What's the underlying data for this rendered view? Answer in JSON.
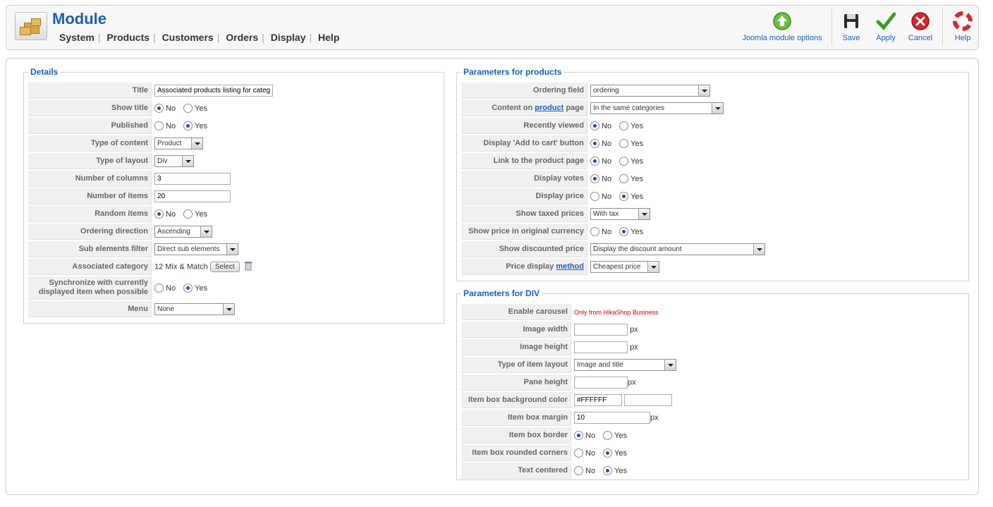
{
  "header": {
    "title": "Module",
    "menu": [
      "System",
      "Products",
      "Customers",
      "Orders",
      "Display",
      "Help"
    ],
    "toolbar": {
      "joomla_options": "Joomla module options",
      "save": "Save",
      "apply": "Apply",
      "cancel": "Cancel",
      "help": "Help"
    }
  },
  "details": {
    "legend": "Details",
    "title_label": "Title",
    "title_value": "Associated products listing for categ",
    "show_title_label": "Show title",
    "published_label": "Published",
    "type_content_label": "Type of content",
    "type_content_value": "Product",
    "type_layout_label": "Type of layout",
    "type_layout_value": "Div",
    "num_columns_label": "Number of columns",
    "num_columns_value": "3",
    "num_items_label": "Number of items",
    "num_items_value": "20",
    "random_label": "Random items",
    "ordering_dir_label": "Ordering direction",
    "ordering_dir_value": "Ascending",
    "sub_filter_label": "Sub elements filter",
    "sub_filter_value": "Direct sub elements",
    "assoc_cat_label": "Associated category",
    "assoc_cat_value": "12 Mix & Match",
    "select_button": "Select",
    "sync_label_1": "Synchronize with currently",
    "sync_label_2": "displayed item when possible",
    "menu_label": "Menu",
    "menu_value": "None",
    "no": "No",
    "yes": "Yes"
  },
  "products": {
    "legend": "Parameters for products",
    "ordering_field_label": "Ordering field",
    "ordering_field_value": "ordering",
    "content_label_pre": "Content on",
    "content_label_link": "product",
    "content_label_post": "page",
    "content_value": "In the same categories",
    "recently_label": "Recently viewed",
    "add_cart_label": "Display 'Add to cart' button",
    "link_label": "Link to the product page",
    "votes_label": "Display votes",
    "price_label": "Display price",
    "taxed_label": "Show taxed prices",
    "taxed_value": "With tax",
    "orig_currency_label": "Show price in original currency",
    "discounted_label": "Show discounted price",
    "discounted_value": "Display the discount amount",
    "price_method_label_pre": "Price display",
    "price_method_label_link": "method",
    "price_method_value": "Cheapest price",
    "no": "No",
    "yes": "Yes"
  },
  "div": {
    "legend": "Parameters for DIV",
    "carousel_label": "Enable carousel",
    "carousel_note": "Only from HikaShop Business",
    "img_width_label": "Image width",
    "img_height_label": "Image height",
    "item_layout_label": "Type of item layout",
    "item_layout_value": "Image and title",
    "pane_height_label": "Pane height",
    "bg_color_label": "Item box background color",
    "bg_color_value": "#FFFFFF",
    "margin_label": "Item box margin",
    "margin_value": "10",
    "border_label": "Item box border",
    "rounded_label": "Item box rounded corners",
    "centered_label": "Text centered",
    "px": "px",
    "no": "No",
    "yes": "Yes"
  }
}
